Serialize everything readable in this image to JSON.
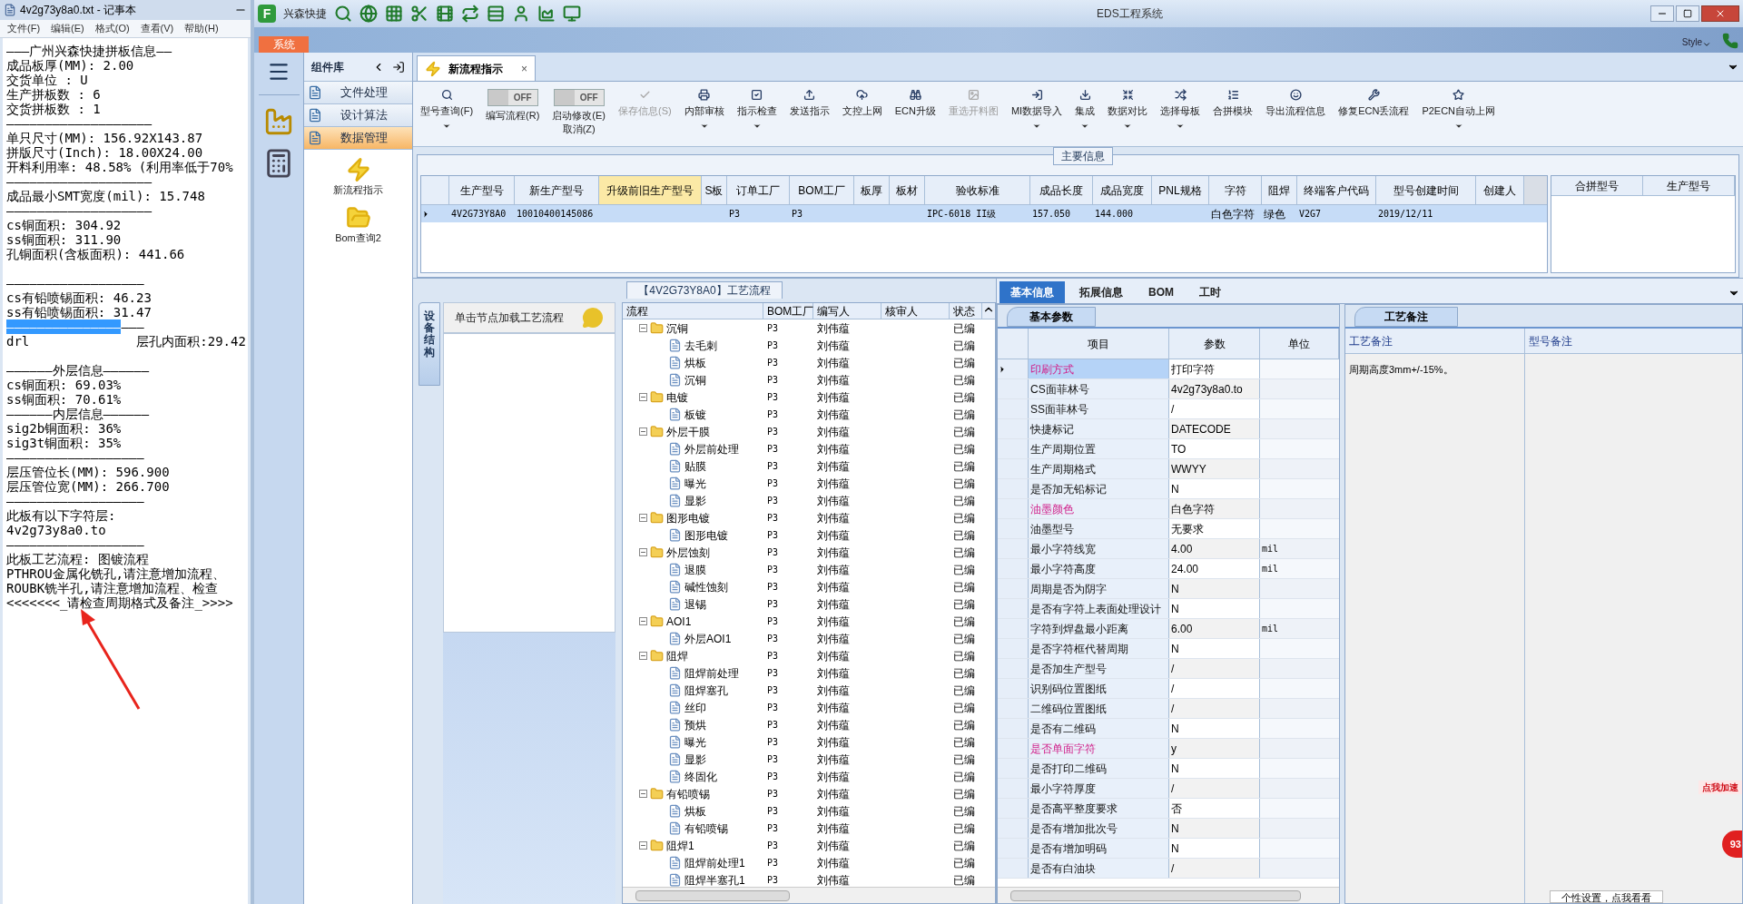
{
  "notepad": {
    "title": "4v2g73y8a0.txt - 记事本",
    "menu": [
      "文件(F)",
      "编辑(E)",
      "格式(O)",
      "查看(V)",
      "帮助(H)"
    ],
    "lines": [
      {
        "text": "———广州兴森快捷拼板信息——",
        "space_before": false,
        "selected": false
      },
      {
        "text": "成品板厚(MM): 2.00",
        "space_before": false,
        "selected": false
      },
      {
        "text": "交货单位 : U",
        "space_before": false,
        "selected": false
      },
      {
        "text": "生产拼板数 : 6",
        "space_before": false,
        "selected": false
      },
      {
        "text": "交货拼板数 : 1",
        "space_before": false,
        "selected": false
      },
      {
        "text": "———————————————————",
        "space_before": false,
        "selected": false
      },
      {
        "text": "单只尺寸(MM): 156.92X143.87",
        "space_before": false,
        "selected": false
      },
      {
        "text": "拼版尺寸(Inch): 18.00X24.00",
        "space_before": false,
        "selected": false
      },
      {
        "text": "开料利用率: 48.58% (利用率低于70%",
        "space_before": false,
        "selected": false
      },
      {
        "text": "———————————————————",
        "space_before": false,
        "selected": false
      },
      {
        "text": "成品最小SMT宽度(mil): 15.748",
        "space_before": false,
        "selected": false
      },
      {
        "text": "———————————————————",
        "space_before": false,
        "selected": false
      },
      {
        "text": "cs铜面积: 304.92",
        "space_before": false,
        "selected": false
      },
      {
        "text": "ss铜面积: 311.90",
        "space_before": false,
        "selected": false
      },
      {
        "text": "孔铜面积(含板面积): 441.66",
        "space_before": false,
        "selected": false
      },
      {
        "text": "——————————————————",
        "space_before": true,
        "selected": false
      },
      {
        "text": "cs有铅喷锡面积: 46.23",
        "space_before": false,
        "selected": false
      },
      {
        "text": "ss有铅喷锡面积: 31.47",
        "space_before": false,
        "selected": false
      },
      {
        "text": "———————————————",
        "space_before": false,
        "selected": true,
        "tail": "———"
      },
      {
        "text": "drl              层孔内面积:29.42",
        "space_before": false,
        "selected": false
      },
      {
        "text": "——————外层信息——————",
        "space_before": true,
        "selected": false
      },
      {
        "text": "cs铜面积: 69.03%",
        "space_before": false,
        "selected": false
      },
      {
        "text": "ss铜面积: 70.61%",
        "space_before": false,
        "selected": false
      },
      {
        "text": "——————内层信息——————",
        "space_before": false,
        "selected": false
      },
      {
        "text": "sig2b铜面积: 36%",
        "space_before": false,
        "selected": false
      },
      {
        "text": "sig3t铜面积: 35%",
        "space_before": false,
        "selected": false
      },
      {
        "text": "——————————————————",
        "space_before": false,
        "selected": false
      },
      {
        "text": "层压管位长(MM): 596.900",
        "space_before": false,
        "selected": false
      },
      {
        "text": "层压管位宽(MM): 266.700",
        "space_before": false,
        "selected": false
      },
      {
        "text": "——————————————————",
        "space_before": false,
        "selected": false
      },
      {
        "text": "此板有以下字符层:",
        "space_before": false,
        "selected": false
      },
      {
        "text": "4v2g73y8a0.to",
        "space_before": false,
        "selected": false
      },
      {
        "text": "——————————————————",
        "space_before": false,
        "selected": false
      },
      {
        "text": "此板工艺流程: 图镀流程",
        "space_before": false,
        "selected": false
      },
      {
        "text": "PTHROU金属化铣孔,请注意增加流程、",
        "space_before": false,
        "selected": false
      },
      {
        "text": "ROUBK铣半孔,请注意增加流程、检查",
        "space_before": false,
        "selected": false
      },
      {
        "text": "<<<<<<<_请检查周期格式及备注_>>>>",
        "space_before": false,
        "selected": false
      }
    ]
  },
  "app": {
    "logo": "F",
    "brand": "兴森快捷",
    "title": "EDS工程系统",
    "system_tab": "系统",
    "style_label": "Style"
  },
  "sidebar": {
    "title": "组件库",
    "groups": [
      {
        "label": "文件处理",
        "selected": false
      },
      {
        "label": "设计算法",
        "selected": false
      },
      {
        "label": "数据管理",
        "selected": true
      }
    ],
    "tools": [
      "新流程指示",
      "Bom查询2"
    ]
  },
  "doc_tab": {
    "label": "新流程指示",
    "close": "×"
  },
  "toolbar": [
    {
      "kind": "button",
      "label": "型号查询(F)",
      "dropdown": true,
      "disabled": false
    },
    {
      "kind": "switch",
      "label": "编写流程(R)",
      "on": false,
      "state_text": "OFF"
    },
    {
      "kind": "switch",
      "label": "启动修改(E)\n取消(Z)",
      "on": false,
      "state_text": "OFF"
    },
    {
      "kind": "button",
      "label": "保存信息(S)",
      "dropdown": false,
      "disabled": true
    },
    {
      "kind": "button",
      "label": "内部审核",
      "dropdown": true,
      "disabled": false
    },
    {
      "kind": "button",
      "label": "指示检查",
      "dropdown": true,
      "disabled": false
    },
    {
      "kind": "button",
      "label": "发送指示",
      "dropdown": false,
      "disabled": false
    },
    {
      "kind": "button",
      "label": "文控上网",
      "dropdown": false,
      "disabled": false
    },
    {
      "kind": "button",
      "label": "ECN升级",
      "dropdown": false,
      "disabled": false
    },
    {
      "kind": "button",
      "label": "重选开料图",
      "dropdown": false,
      "disabled": true
    },
    {
      "kind": "button",
      "label": "MI数据导入",
      "dropdown": true,
      "disabled": false
    },
    {
      "kind": "button",
      "label": "集成",
      "dropdown": true,
      "disabled": false
    },
    {
      "kind": "button",
      "label": "数据对比",
      "dropdown": true,
      "disabled": false
    },
    {
      "kind": "button",
      "label": "选择母板",
      "dropdown": true,
      "disabled": false
    },
    {
      "kind": "button",
      "label": "合拼模块",
      "dropdown": false,
      "disabled": false
    },
    {
      "kind": "button",
      "label": "导出流程信息",
      "dropdown": false,
      "disabled": false
    },
    {
      "kind": "button",
      "label": "修复ECN丢流程",
      "dropdown": false,
      "disabled": false
    },
    {
      "kind": "button",
      "label": "P2ECN自动上网",
      "dropdown": true,
      "disabled": false
    }
  ],
  "main_info": {
    "title": "主要信息",
    "columns": [
      {
        "label": "生产型号",
        "highlighted": false
      },
      {
        "label": "新生产型号",
        "highlighted": false
      },
      {
        "label": "升级前旧生产型号",
        "highlighted": true
      },
      {
        "label": "S板",
        "highlighted": false
      },
      {
        "label": "订单工厂",
        "highlighted": false
      },
      {
        "label": "BOM工厂",
        "highlighted": false
      },
      {
        "label": "板厚",
        "highlighted": false
      },
      {
        "label": "板材",
        "highlighted": false
      },
      {
        "label": "验收标准",
        "highlighted": false
      },
      {
        "label": "成品长度",
        "highlighted": false
      },
      {
        "label": "成品宽度",
        "highlighted": false
      },
      {
        "label": "PNL规格",
        "highlighted": false
      },
      {
        "label": "字符",
        "highlighted": false
      },
      {
        "label": "阻焊",
        "highlighted": false
      },
      {
        "label": "终端客户代码",
        "highlighted": false
      },
      {
        "label": "型号创建时间",
        "highlighted": false
      },
      {
        "label": "创建人",
        "highlighted": false
      }
    ],
    "rows": [
      {
        "selected": true,
        "cells": [
          "4V2G73Y8A0",
          "10010400145086",
          null,
          null,
          "P3",
          "P3",
          null,
          null,
          "IPC-6018 II级",
          "157.050",
          "144.000",
          null,
          "白色字符",
          "绿色",
          "V2G7",
          "2019/12/11",
          null
        ]
      }
    ],
    "side_columns": [
      "合拼型号",
      "生产型号"
    ]
  },
  "process": {
    "title": "【4V2G73Y8A0】工艺流程",
    "side_tab": "设备结构",
    "hint": "单击节点加载工艺流程",
    "columns": [
      "流程",
      "BOM工厂",
      "编写人",
      "核审人",
      "状态"
    ],
    "tree": [
      {
        "name": "沉铜",
        "bom": "P3",
        "writer": "刘伟蕴",
        "status": "已编",
        "expanded": true,
        "children": [
          {
            "name": "去毛刺",
            "bom": "P3",
            "writer": "刘伟蕴",
            "status": "已编"
          },
          {
            "name": "烘板",
            "bom": "P3",
            "writer": "刘伟蕴",
            "status": "已编"
          },
          {
            "name": "沉铜",
            "bom": "P3",
            "writer": "刘伟蕴",
            "status": "已编"
          }
        ]
      },
      {
        "name": "电镀",
        "bom": "P3",
        "writer": "刘伟蕴",
        "status": "已编",
        "expanded": true,
        "children": [
          {
            "name": "板镀",
            "bom": "P3",
            "writer": "刘伟蕴",
            "status": "已编"
          }
        ]
      },
      {
        "name": "外层干膜",
        "bom": "P3",
        "writer": "刘伟蕴",
        "status": "已编",
        "expanded": true,
        "children": [
          {
            "name": "外层前处理",
            "bom": "P3",
            "writer": "刘伟蕴",
            "status": "已编"
          },
          {
            "name": "贴膜",
            "bom": "P3",
            "writer": "刘伟蕴",
            "status": "已编"
          },
          {
            "name": "曝光",
            "bom": "P3",
            "writer": "刘伟蕴",
            "status": "已编"
          },
          {
            "name": "显影",
            "bom": "P3",
            "writer": "刘伟蕴",
            "status": "已编"
          }
        ]
      },
      {
        "name": "图形电镀",
        "bom": "P3",
        "writer": "刘伟蕴",
        "status": "已编",
        "expanded": true,
        "children": [
          {
            "name": "图形电镀",
            "bom": "P3",
            "writer": "刘伟蕴",
            "status": "已编"
          }
        ]
      },
      {
        "name": "外层蚀刻",
        "bom": "P3",
        "writer": "刘伟蕴",
        "status": "已编",
        "expanded": true,
        "children": [
          {
            "name": "退膜",
            "bom": "P3",
            "writer": "刘伟蕴",
            "status": "已编"
          },
          {
            "name": "碱性蚀刻",
            "bom": "P3",
            "writer": "刘伟蕴",
            "status": "已编"
          },
          {
            "name": "退锡",
            "bom": "P3",
            "writer": "刘伟蕴",
            "status": "已编"
          }
        ]
      },
      {
        "name": "AOI1",
        "bom": "P3",
        "writer": "刘伟蕴",
        "status": "已编",
        "expanded": true,
        "children": [
          {
            "name": "外层AOI1",
            "bom": "P3",
            "writer": "刘伟蕴",
            "status": "已编"
          }
        ]
      },
      {
        "name": "阻焊",
        "bom": "P3",
        "writer": "刘伟蕴",
        "status": "已编",
        "expanded": true,
        "children": [
          {
            "name": "阻焊前处理",
            "bom": "P3",
            "writer": "刘伟蕴",
            "status": "已编"
          },
          {
            "name": "阻焊塞孔",
            "bom": "P3",
            "writer": "刘伟蕴",
            "status": "已编"
          },
          {
            "name": "丝印",
            "bom": "P3",
            "writer": "刘伟蕴",
            "status": "已编"
          },
          {
            "name": "预烘",
            "bom": "P3",
            "writer": "刘伟蕴",
            "status": "已编"
          },
          {
            "name": "曝光",
            "bom": "P3",
            "writer": "刘伟蕴",
            "status": "已编"
          },
          {
            "name": "显影",
            "bom": "P3",
            "writer": "刘伟蕴",
            "status": "已编"
          },
          {
            "name": "终固化",
            "bom": "P3",
            "writer": "刘伟蕴",
            "status": "已编"
          }
        ]
      },
      {
        "name": "有铅喷锡",
        "bom": "P3",
        "writer": "刘伟蕴",
        "status": "已编",
        "expanded": true,
        "children": [
          {
            "name": "烘板",
            "bom": "P3",
            "writer": "刘伟蕴",
            "status": "已编"
          },
          {
            "name": "有铅喷锡",
            "bom": "P3",
            "writer": "刘伟蕴",
            "status": "已编"
          }
        ]
      },
      {
        "name": "阻焊1",
        "bom": "P3",
        "writer": "刘伟蕴",
        "status": "已编",
        "expanded": true,
        "children": [
          {
            "name": "阻焊前处理1",
            "bom": "P3",
            "writer": "刘伟蕴",
            "status": "已编"
          },
          {
            "name": "阻焊半塞孔1",
            "bom": "P3",
            "writer": "刘伟蕴",
            "status": "已编"
          }
        ]
      }
    ]
  },
  "detail": {
    "tabs": [
      {
        "label": "基本信息",
        "selected": true
      },
      {
        "label": "拓展信息",
        "selected": false
      },
      {
        "label": "BOM",
        "selected": false
      },
      {
        "label": "工时",
        "selected": false
      }
    ],
    "params": {
      "title": "基本参数",
      "columns": [
        "项目",
        "参数",
        "单位"
      ],
      "rows": [
        {
          "item": "印刷方式",
          "value": "打印字符",
          "flagged": true,
          "selected": true
        },
        {
          "item": "CS面菲林号",
          "value": "4v2g73y8a0.to",
          "flagged": false,
          "selected": false
        },
        {
          "item": "SS面菲林号",
          "value": "/",
          "flagged": false,
          "selected": false
        },
        {
          "item": "快捷标记",
          "value": "DATECODE",
          "flagged": false,
          "selected": false
        },
        {
          "item": "生产周期位置",
          "value": "TO",
          "flagged": false,
          "selected": false
        },
        {
          "item": "生产周期格式",
          "value": "WWYY",
          "flagged": false,
          "selected": false
        },
        {
          "item": "是否加无铅标记",
          "value": "N",
          "flagged": false,
          "selected": false
        },
        {
          "item": "油墨颜色",
          "value": "白色字符",
          "flagged": true,
          "selected": false
        },
        {
          "item": "油墨型号",
          "value": "无要求",
          "flagged": false,
          "selected": false
        },
        {
          "item": "最小字符线宽",
          "value": "4.00",
          "unit": "mil",
          "flagged": false,
          "selected": false
        },
        {
          "item": "最小字符高度",
          "value": "24.00",
          "unit": "mil",
          "flagged": false,
          "selected": false
        },
        {
          "item": "周期是否为阴字",
          "value": "N",
          "flagged": false,
          "selected": false
        },
        {
          "item": "是否有字符上表面处理设计",
          "value": "N",
          "flagged": false,
          "selected": false
        },
        {
          "item": "字符到焊盘最小距离",
          "value": "6.00",
          "unit": "mil",
          "flagged": false,
          "selected": false
        },
        {
          "item": "是否字符框代替周期",
          "value": "N",
          "flagged": false,
          "selected": false
        },
        {
          "item": "是否加生产型号",
          "value": "/",
          "flagged": false,
          "selected": false
        },
        {
          "item": "识别码位置图纸",
          "value": "/",
          "flagged": false,
          "selected": false
        },
        {
          "item": "二维码位置图纸",
          "value": "/",
          "flagged": false,
          "selected": false
        },
        {
          "item": "是否有二维码",
          "value": "N",
          "flagged": false,
          "selected": false
        },
        {
          "item": "是否单面字符",
          "value": "y",
          "flagged": true,
          "selected": false
        },
        {
          "item": "是否打印二维码",
          "value": "N",
          "flagged": false,
          "selected": false
        },
        {
          "item": "最小字符厚度",
          "value": "/",
          "flagged": false,
          "selected": false
        },
        {
          "item": "是否高平整度要求",
          "value": "否",
          "flagged": false,
          "selected": false
        },
        {
          "item": "是否有增加批次号",
          "value": "N",
          "flagged": false,
          "selected": false
        },
        {
          "item": "是否有增加明码",
          "value": "N",
          "flagged": false,
          "selected": false
        },
        {
          "item": "是否有白油块",
          "value": "/",
          "flagged": false,
          "selected": false
        }
      ]
    },
    "notes": {
      "title": "工艺备注",
      "columns": [
        "工艺备注",
        "型号备注"
      ],
      "text": "周期高度3mm+/-15%。"
    },
    "settings_button": "个性设置，点我看看"
  },
  "speed_widget": {
    "label": "点我加速",
    "count": "93"
  }
}
